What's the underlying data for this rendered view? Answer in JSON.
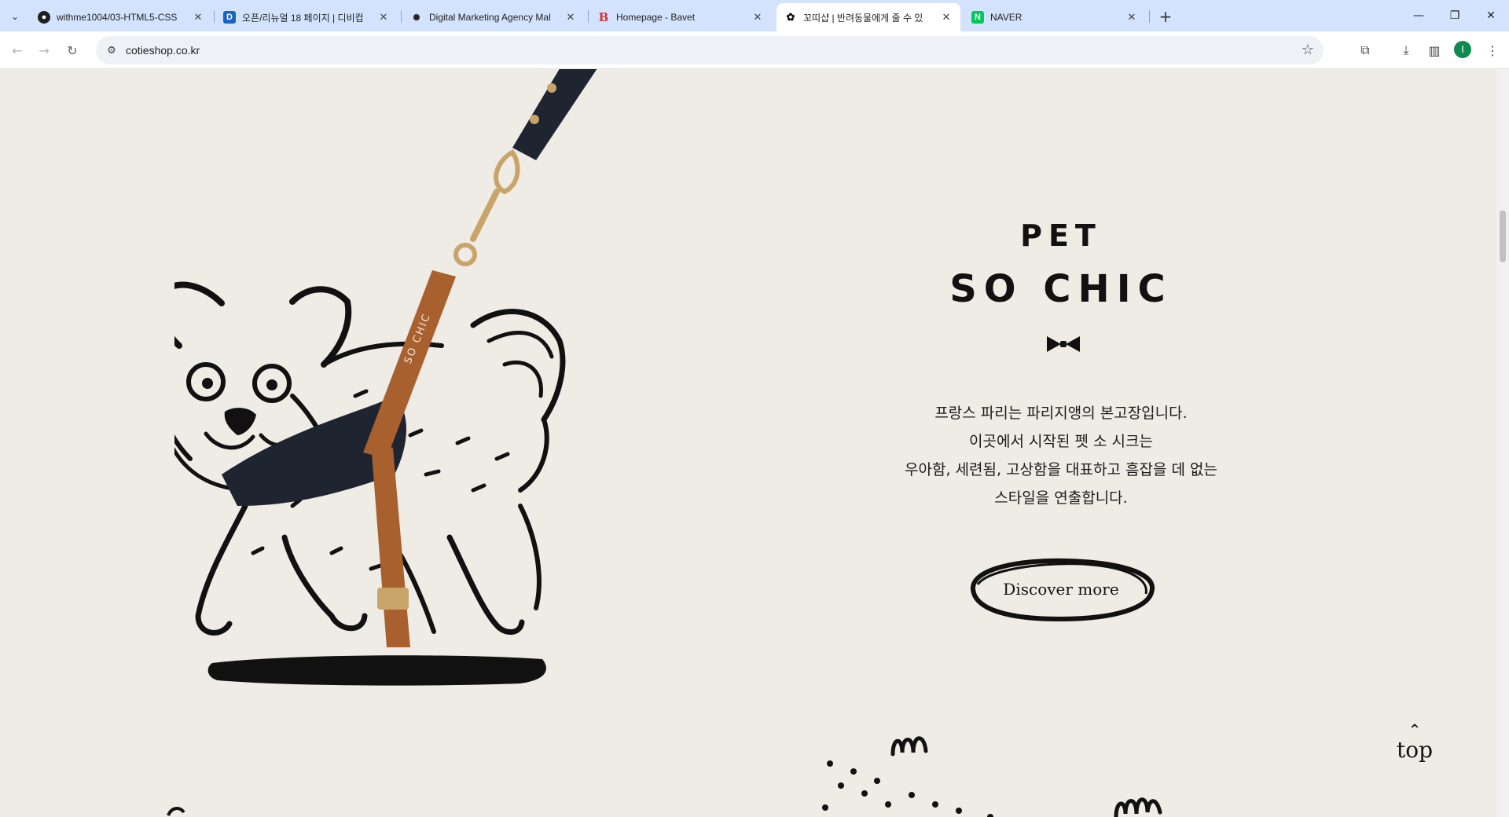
{
  "browser": {
    "tabs": [
      {
        "title": "withme1004/03-HTML5-CSS",
        "favicon": "github-icon"
      },
      {
        "title": "오픈/리뉴얼 18 페이지 | 디비컴",
        "favicon": "d-logo-icon"
      },
      {
        "title": "Digital Marketing Agency Mal",
        "favicon": "agency-icon"
      },
      {
        "title": "Homepage - Bavet",
        "favicon": "b-logo-icon"
      },
      {
        "title": "꼬띠샵 | 반려동물에게 줄 수 있",
        "favicon": "paw-icon",
        "active": true
      },
      {
        "title": "NAVER",
        "favicon": "naver-icon"
      }
    ],
    "url": "cotieshop.co.kr",
    "profile_initial": "I"
  },
  "hero": {
    "title_line1": "PET",
    "title_line2": "SO CHIC",
    "strap_text": "SO CHIC",
    "description": [
      "프랑스 파리는 파리지앵의 본고장입니다.",
      "이곳에서 시작된 펫 소 시크는",
      "우아함, 세련됨, 고상함을 대표하고 흠잡을 데 없는",
      "스타일을 연출합니다."
    ],
    "cta_label": "Discover more"
  },
  "top_button": {
    "label": "top"
  },
  "colors": {
    "page_bg": "#efebe5",
    "ink": "#111111",
    "leather": "#a8602f",
    "harness": "#1e2430",
    "brass": "#c9a46a"
  }
}
